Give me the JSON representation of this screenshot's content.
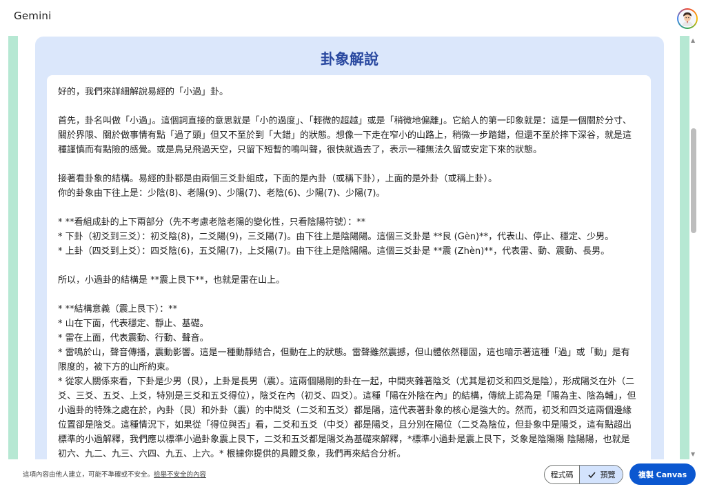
{
  "app": {
    "title": "Gemini"
  },
  "canvas": {
    "card_title": "卦象解說",
    "paragraphs": [
      "好的，我們來詳細解說易經的「小過」卦。",
      "",
      "首先，卦名叫做「小過」。這個詞直接的意思就是「小的過度」、「輕微的超越」或是「稍微地偏離」。它給人的第一印象就是：這是一個關於分寸、關於界限、關於做事情有點「過了頭」但又不至於到「大錯」的狀態。想像一下走在窄小的山路上，稍微一步踏錯，但還不至於摔下深谷，就是這種謹慎而有點險的感覺。或是鳥兒飛過天空，只留下短暫的鳴叫聲，很快就過去了，表示一種無法久留或安定下來的狀態。",
      "",
      "接著看卦象的結構。易經的卦都是由兩個三爻卦組成，下面的是內卦（或稱下卦），上面的是外卦（或稱上卦）。\n你的卦象由下往上是：少陰(8)、老陽(9)、少陽(7)、老陰(6)、少陽(7)、少陽(7)。",
      "",
      "* **看組成卦的上下兩部分（先不考慮老陰老陽的變化性，只看陰陽符號）：**\n* 下卦（初爻到三爻）：初爻陰(8)，二爻陽(9)，三爻陽(7)。由下往上是陰陽陽。這個三爻卦是 **艮 (Gèn)**，代表山、停止、穩定、少男。\n* 上卦（四爻到上爻）：四爻陰(6)，五爻陽(7)，上爻陽(7)。由下往上是陰陽陽。這個三爻卦是 **震 (Zhèn)**，代表雷、動、震動、長男。",
      "",
      "所以，小過卦的結構是 **震上艮下**，也就是雷在山上。",
      "",
      "* **結構意義（震上艮下）：**\n* 山在下面，代表穩定、靜止、基礎。\n* 雷在上面，代表震動、行動、聲音。\n* 雷鳴於山，聲音傳播，震動影響。這是一種動靜結合，但動在上的狀態。雷聲雖然震撼，但山體依然穩固，這也暗示著這種「過」或「動」是有限度的，被下方的山所約束。\n* 從家人關係來看，下卦是少男（艮），上卦是長男（震）。這兩個陽剛的卦在一起，中間夾雜著陰爻（尤其是初爻和四爻是陰），形成陽爻在外（二爻、三爻、五爻、上爻，特別是三爻和五爻得位），陰爻在內（初爻、四爻）。這種「陽在外陰在內」的結構，傳統上認為是「陽為主、陰為輔」，但小過卦的特殊之處在於，內卦（艮）和外卦（震）的中間爻（二爻和五爻）都是陽，這代表著卦象的核心是強大的。然而，初爻和四爻這兩個邊緣位置卻是陰爻。這種情況下，如果從「得位與否」看，二爻和五爻（中爻）都是陽爻，且分別在陽位（二爻為陰位，但卦象中是陽爻，這有點超出標準的小過解釋，我們應以標準小過卦象震上艮下，二爻和五爻都是陽爻為基礎來解釋，*標準小過卦是震上艮下，爻象是陰陽陽 陰陽陽，也就是初六、九二、九三、六四、九五、上六。* 根據你提供的具體爻象，我們再來結合分析。"
    ]
  },
  "footer": {
    "disclaimer": "這項內容由他人建立，可能不準確或不安全。",
    "report_link": "檢舉不安全的內容",
    "code_tab": "程式碼",
    "preview_tab": "預覽",
    "copy_button": "複製 Canvas"
  },
  "icons": {
    "avatar": "avatar-icon",
    "check": "check-icon"
  },
  "colors": {
    "card_bg": "#dbe7fb",
    "title": "#2a49a0",
    "accent": "#0b57d0",
    "band": "#b6e8d3"
  }
}
